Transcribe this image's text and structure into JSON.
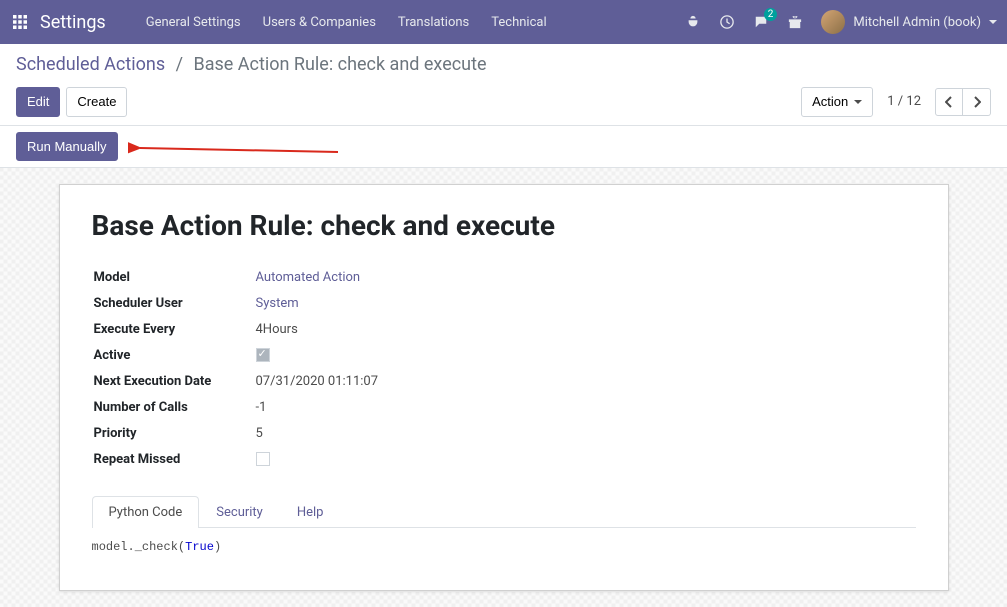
{
  "topnav": {
    "app_title": "Settings",
    "menu": [
      "General Settings",
      "Users & Companies",
      "Translations",
      "Technical"
    ],
    "messages_badge": "2",
    "user_name": "Mitchell Admin (book)"
  },
  "breadcrumb": {
    "parent": "Scheduled Actions",
    "current": "Base Action Rule: check and execute"
  },
  "buttons": {
    "edit": "Edit",
    "create": "Create",
    "action": "Action",
    "run_manually": "Run Manually"
  },
  "pager": {
    "text": "1 / 12"
  },
  "form": {
    "title": "Base Action Rule: check and execute",
    "fields": {
      "model_label": "Model",
      "model_value": "Automated Action",
      "scheduler_user_label": "Scheduler User",
      "scheduler_user_value": "System",
      "execute_every_label": "Execute Every",
      "execute_every_value": "4Hours",
      "active_label": "Active",
      "next_exec_label": "Next Execution Date",
      "next_exec_value": "07/31/2020 01:11:07",
      "num_calls_label": "Number of Calls",
      "num_calls_value": "-1",
      "priority_label": "Priority",
      "priority_value": "5",
      "repeat_missed_label": "Repeat Missed"
    },
    "tabs": [
      "Python Code",
      "Security",
      "Help"
    ],
    "code_prefix": "model._check(",
    "code_token": "True",
    "code_suffix": ")"
  }
}
